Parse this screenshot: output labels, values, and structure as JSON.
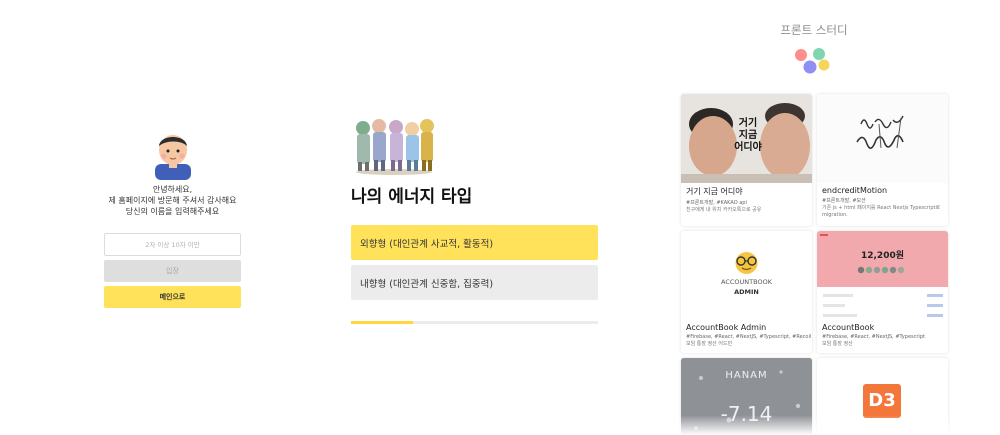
{
  "login": {
    "greeting_line1": "안녕하세요,",
    "greeting_line2": "제 홈페이지에 방문해 주셔서 감사해요",
    "greeting_line3": "당신의 이름을 입력해주세요",
    "name_placeholder": "2자 이상 10자 이만",
    "enter_label": "입장",
    "main_label": "메인으로"
  },
  "quiz": {
    "title": "나의 에너지 타입",
    "options": [
      {
        "label": "외향형 (대인관계 사교적, 활동적)",
        "selected": true
      },
      {
        "label": "내향형 (대인관계 신중함, 집중력)",
        "selected": false
      }
    ],
    "progress": 0.25,
    "accent": "#ffe25a"
  },
  "portfolio": {
    "title": "프론트 스터디",
    "cards": [
      {
        "title": "거기 지금 어디야",
        "tags": "#프론트개발, #KAKAO api",
        "desc": "친구에게 내 위치 카카오톡으로 공유",
        "thumb_text": [
          "거기",
          "지금",
          "어디야"
        ]
      },
      {
        "title": "endcreditMotion",
        "tags": "#프론트개발, #모션",
        "desc": "기존 js + html 페이지를 React Nextjs Typescript로 migration."
      },
      {
        "title": "AccountBook Admin",
        "tags": "#Firebase, #React, #NextJS, #Typescript, #Recoil",
        "desc": "모임 통장 정산 어드민",
        "thumb_text": [
          "ACCOUNTBOOK",
          "ADMIN"
        ]
      },
      {
        "title": "AccountBook",
        "tags": "#Firebase, #React, #NextJS, #Typescript",
        "desc": "모임 통장 정산",
        "thumb_text": [
          "12,200원"
        ]
      },
      {
        "thumb_text": [
          "HANAM",
          "-7.14"
        ]
      },
      {
        "thumb_text": [
          "D3"
        ]
      }
    ]
  }
}
